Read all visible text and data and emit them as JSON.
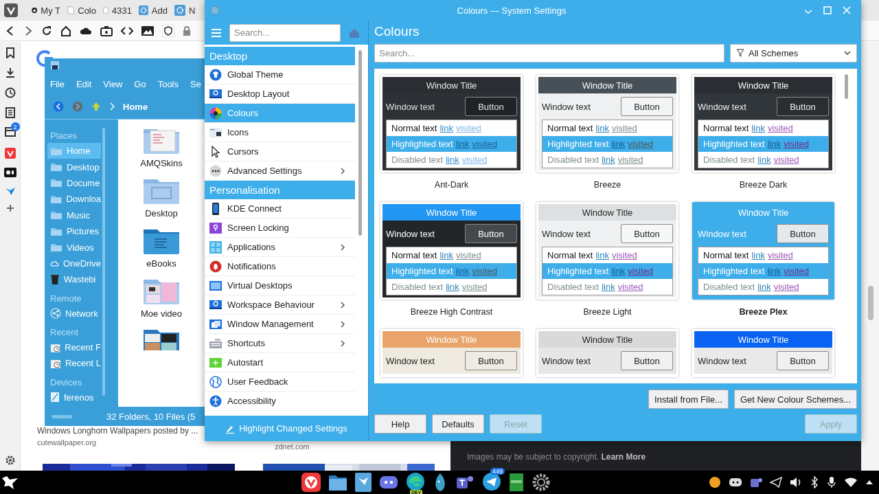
{
  "browser": {
    "tabs": [
      {
        "title": "My T"
      },
      {
        "title": "Colo"
      },
      {
        "title": "4331"
      },
      {
        "title": "Add"
      },
      {
        "title": "N"
      }
    ],
    "panel_badge": "2",
    "result": {
      "title": "Windows Longhorn Wallpapers posted by ...",
      "source": "cutewallpaper.org"
    },
    "second_source": "zdnet.com",
    "image_notice": "Images may be subject to copyright. **Learn More**"
  },
  "file_manager": {
    "menu": [
      "File",
      "Edit",
      "View",
      "Go",
      "Tools",
      "Se"
    ],
    "location": "Home",
    "places": [
      {
        "kind": "header",
        "label": "Places"
      },
      {
        "kind": "item",
        "label": "Home",
        "selected": true
      },
      {
        "kind": "item",
        "label": "Desktop",
        "selected": false
      },
      {
        "kind": "item",
        "label": "Docume",
        "selected": false
      },
      {
        "kind": "item",
        "label": "Downloa",
        "selected": false
      },
      {
        "kind": "item",
        "label": "Music",
        "selected": false
      },
      {
        "kind": "item",
        "label": "Pictures",
        "selected": false
      },
      {
        "kind": "item",
        "label": "Videos",
        "selected": false
      },
      {
        "kind": "item",
        "label": "OneDrive",
        "selected": false
      },
      {
        "kind": "item",
        "label": "Wastebi",
        "selected": false
      },
      {
        "kind": "header",
        "label": "Remote"
      },
      {
        "kind": "item",
        "label": "Network",
        "selected": false
      },
      {
        "kind": "header",
        "label": "Recent"
      },
      {
        "kind": "item",
        "label": "Recent F",
        "selected": false
      },
      {
        "kind": "item",
        "label": "Recent L",
        "selected": false
      },
      {
        "kind": "header",
        "label": "Devices"
      },
      {
        "kind": "item",
        "label": "ferenos",
        "selected": false
      }
    ],
    "files": [
      {
        "kind": "folder",
        "name": "AMQSkins"
      },
      {
        "kind": "folder",
        "name": "Desktop"
      },
      {
        "kind": "folder",
        "name": "eBooks"
      },
      {
        "kind": "folder",
        "name": "Moe video"
      },
      {
        "kind": "folder"
      }
    ],
    "status": "32 Folders, 10 Files (5"
  },
  "settings": {
    "title": "Colours — System Settings",
    "search_placeholder": "Search...",
    "sidebar": [
      {
        "kind": "header",
        "label": "Desktop"
      },
      {
        "kind": "item",
        "label": "Global Theme",
        "selected": false,
        "submenu": false
      },
      {
        "kind": "item",
        "label": "Desktop Layout",
        "selected": false,
        "submenu": false
      },
      {
        "kind": "item",
        "label": "Colours",
        "selected": true,
        "submenu": false
      },
      {
        "kind": "item",
        "label": "Icons",
        "selected": false,
        "submenu": false
      },
      {
        "kind": "item",
        "label": "Cursors",
        "selected": false,
        "submenu": false
      },
      {
        "kind": "item",
        "label": "Advanced Settings",
        "selected": false,
        "submenu": true
      },
      {
        "kind": "header",
        "label": "Personalisation"
      },
      {
        "kind": "item",
        "label": "KDE Connect",
        "selected": false,
        "submenu": false
      },
      {
        "kind": "item",
        "label": "Screen Locking",
        "selected": false,
        "submenu": false
      },
      {
        "kind": "item",
        "label": "Applications",
        "selected": false,
        "submenu": true
      },
      {
        "kind": "item",
        "label": "Notifications",
        "selected": false,
        "submenu": false
      },
      {
        "kind": "item",
        "label": "Virtual Desktops",
        "selected": false,
        "submenu": false
      },
      {
        "kind": "item",
        "label": "Workspace Behaviour",
        "selected": false,
        "submenu": true
      },
      {
        "kind": "item",
        "label": "Window Management",
        "selected": false,
        "submenu": true
      },
      {
        "kind": "item",
        "label": "Shortcuts",
        "selected": false,
        "submenu": true
      },
      {
        "kind": "item",
        "label": "Autostart",
        "selected": false,
        "submenu": false
      },
      {
        "kind": "item",
        "label": "User Feedback",
        "selected": false,
        "submenu": false
      },
      {
        "kind": "item",
        "label": "Accessibility",
        "selected": false,
        "submenu": false
      }
    ],
    "footer": "Highlight Changed Settings",
    "page_title": "Colours",
    "page_search_placeholder": "Search...",
    "filter": "All Schemes",
    "schemes": [
      {
        "name": "Ant-Dark",
        "selected": false,
        "kind": "full",
        "title": "Window Title",
        "window_text": "Window text",
        "button": "Button",
        "lines": [
          {
            "kind": "normal",
            "text": "Normal text",
            "link": "link",
            "visited": "visited"
          },
          {
            "kind": "highlighted",
            "text": "Highlighted text",
            "link": "link",
            "visited": "visited"
          },
          {
            "kind": "disabled",
            "text": "Disabled text",
            "link": "link",
            "visited": "visited"
          }
        ]
      },
      {
        "name": "Breeze",
        "selected": false,
        "kind": "full",
        "title": "Window Title",
        "window_text": "Window text",
        "button": "Button",
        "lines": [
          {
            "kind": "normal",
            "text": "Normal text",
            "link": "link",
            "visited": "visited"
          },
          {
            "kind": "highlighted",
            "text": "Highlighted text",
            "link": "link",
            "visited": "visited"
          },
          {
            "kind": "disabled",
            "text": "Disabled text",
            "link": "link",
            "visited": "visited"
          }
        ]
      },
      {
        "name": "Breeze Dark",
        "selected": false,
        "kind": "full",
        "title": "Window Title",
        "window_text": "Window text",
        "button": "Button",
        "lines": [
          {
            "kind": "normal",
            "text": "Normal text",
            "link": "link",
            "visited": "visited"
          },
          {
            "kind": "highlighted",
            "text": "Highlighted text",
            "link": "link",
            "visited": "visited"
          },
          {
            "kind": "disabled",
            "text": "Disabled text",
            "link": "link",
            "visited": "visited"
          }
        ]
      },
      {
        "name": "Breeze High Contrast",
        "selected": false,
        "kind": "full",
        "title": "Window Title",
        "window_text": "Window text",
        "button": "Button",
        "lines": [
          {
            "kind": "normal",
            "text": "Normal text",
            "link": "link",
            "visited": "visited"
          },
          {
            "kind": "highlighted",
            "text": "Highlighted text",
            "link": "link",
            "visited": "visited"
          },
          {
            "kind": "disabled",
            "text": "Disabled text",
            "link": "link",
            "visited": "visited"
          }
        ]
      },
      {
        "name": "Breeze Light",
        "selected": false,
        "kind": "full",
        "title": "Window Title",
        "window_text": "Window text",
        "button": "Button",
        "lines": [
          {
            "kind": "normal",
            "text": "Normal text",
            "link": "link",
            "visited": "visited"
          },
          {
            "kind": "highlighted",
            "text": "Highlighted text",
            "link": "link",
            "visited": "visited"
          },
          {
            "kind": "disabled",
            "text": "Disabled text",
            "link": "link",
            "visited": "visited"
          }
        ]
      },
      {
        "name": "Breeze Plex",
        "selected": true,
        "kind": "full",
        "title": "Window Title",
        "window_text": "Window text",
        "button": "Button",
        "lines": [
          {
            "kind": "normal",
            "text": "Normal text",
            "link": "link",
            "visited": "visited"
          },
          {
            "kind": "highlighted",
            "text": "Highlighted text",
            "link": "link",
            "visited": "visited"
          },
          {
            "kind": "disabled",
            "text": "Disabled text",
            "link": "link",
            "visited": "visited"
          }
        ]
      },
      {
        "selected": false,
        "kind": "partial",
        "title": "Window Title",
        "window_text": "Window text",
        "button": "Button"
      },
      {
        "selected": false,
        "kind": "partial",
        "title": "Window Title",
        "window_text": "Window text",
        "button": "Button"
      },
      {
        "selected": false,
        "kind": "partial",
        "title": "Window Title",
        "window_text": "Window text",
        "button": "Button"
      }
    ],
    "scheme_buttons": [
      {
        "label": "Install from File...",
        "disabled": false
      },
      {
        "label": "Get New Colour Schemes...",
        "disabled": false
      }
    ],
    "dialog_buttons": [
      {
        "label": "Help",
        "disabled": false
      },
      {
        "label": "Defaults",
        "disabled": false
      },
      {
        "label": "Reset",
        "disabled": true
      },
      {
        "label": "Apply",
        "disabled": true
      }
    ]
  },
  "taskbar": {
    "edge_label": "DEV",
    "telegram_badge": "449"
  }
}
